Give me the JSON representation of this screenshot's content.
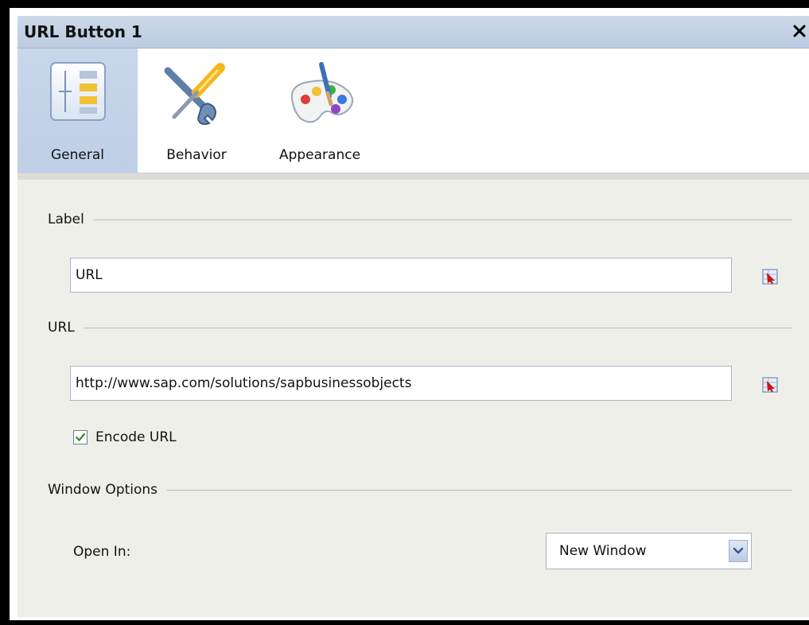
{
  "window": {
    "title": "URL Button 1",
    "close_glyph": "✕"
  },
  "tabs": [
    {
      "label": "General",
      "icon": "general-properties-icon",
      "active": true
    },
    {
      "label": "Behavior",
      "icon": "tools-icon",
      "active": false
    },
    {
      "label": "Appearance",
      "icon": "palette-icon",
      "active": false
    }
  ],
  "label_section": {
    "heading": "Label",
    "value": "URL",
    "bind_icon": "bind-to-cell-icon"
  },
  "url_section": {
    "heading": "URL",
    "value": "http://www.sap.com/solutions/sapbusinessobjects",
    "bind_icon": "bind-to-cell-icon",
    "encode_label": "Encode URL",
    "encode_checked": true
  },
  "window_options": {
    "heading": "Window Options",
    "open_in_label": "Open In:",
    "open_in_value": "New Window"
  },
  "colors": {
    "active_tab": "#c3d2e8",
    "title_bar": "#c5d3e6",
    "content_bg": "#efefea",
    "check_green": "#2e8b3a",
    "bind_red": "#cc1111"
  }
}
